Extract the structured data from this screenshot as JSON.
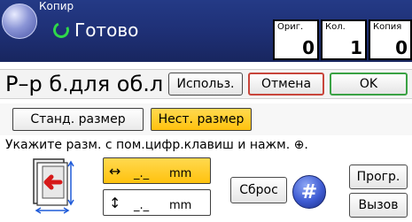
{
  "app": {
    "title": "Копир",
    "status": "Готово"
  },
  "counters": [
    {
      "label": "Ориг.",
      "value": "0"
    },
    {
      "label": "Кол.",
      "value": "1"
    },
    {
      "label": "Копия",
      "value": "0"
    }
  ],
  "page": {
    "title": "Р–р б.для об.л"
  },
  "toolbar": {
    "use_label": "Использ.",
    "cancel_label": "Отмена",
    "ok_label": "OK"
  },
  "size_tabs": {
    "standard": "Станд. размер",
    "custom": "Нест. размер"
  },
  "instruction": "Укажите разм. с пом.цифр.клавиш и нажм. ⊕.",
  "fields": {
    "horizontal": {
      "arrow": "↔",
      "value": "_._",
      "unit": "mm"
    },
    "vertical": {
      "arrow": "↕",
      "value": "_._",
      "unit": "mm"
    }
  },
  "buttons": {
    "reset": "Сброс",
    "hash": "#",
    "program": "Прогр.",
    "recall": "Вызов"
  },
  "colors": {
    "header": "#1e2f74",
    "accent": "#ffc20e",
    "ready": "#2fd84a",
    "cancel_border": "#c8453b",
    "ok_border": "#3aa244"
  }
}
